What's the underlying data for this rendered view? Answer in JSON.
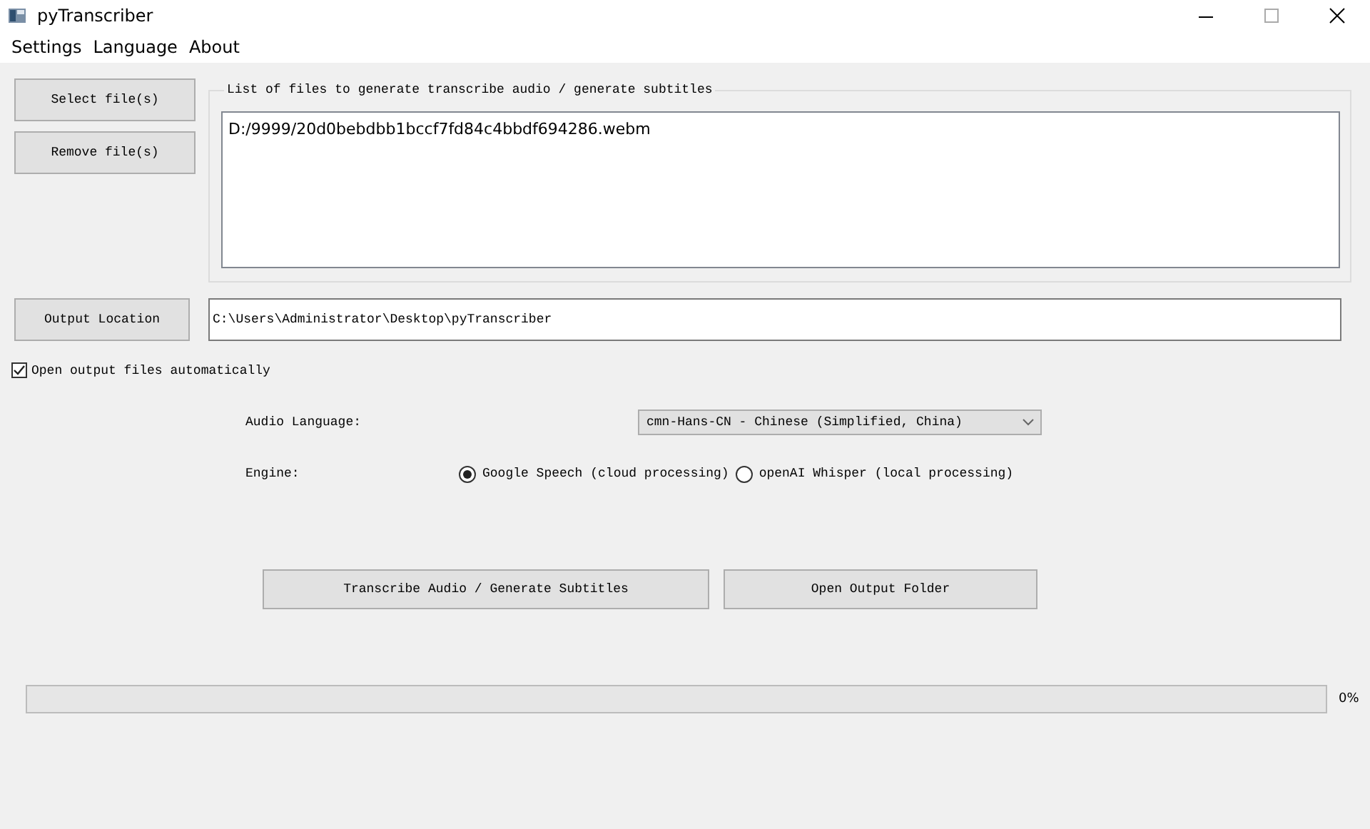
{
  "window": {
    "title": "pyTranscriber"
  },
  "menu": [
    "Settings",
    "Language",
    "About"
  ],
  "files": {
    "buttons": [
      "Select file(s)",
      "Remove file(s)"
    ],
    "group_title": "List of files to generate transcribe audio / generate subtitles",
    "items": [
      "D:/9999/20d0bebdbb1bccf7fd84c4bbdf694286.webm"
    ]
  },
  "output": {
    "button": "Output Location",
    "path": "C:\\Users\\Administrator\\Desktop\\pyTranscriber"
  },
  "open_automatically": {
    "label": "Open output files automatically",
    "checked": true
  },
  "audio_language": {
    "label": "Audio Language:",
    "value": "cmn-Hans-CN - Chinese (Simplified, China)"
  },
  "engine": {
    "label": "Engine:",
    "options": [
      {
        "label": "Google Speech (cloud processing)",
        "selected": true
      },
      {
        "label": "openAI Whisper (local processing)",
        "selected": false
      }
    ]
  },
  "actions": [
    "Transcribe Audio / Generate Subtitles",
    "Open Output Folder"
  ],
  "progress": {
    "level": 0,
    "reading": "0%"
  }
}
